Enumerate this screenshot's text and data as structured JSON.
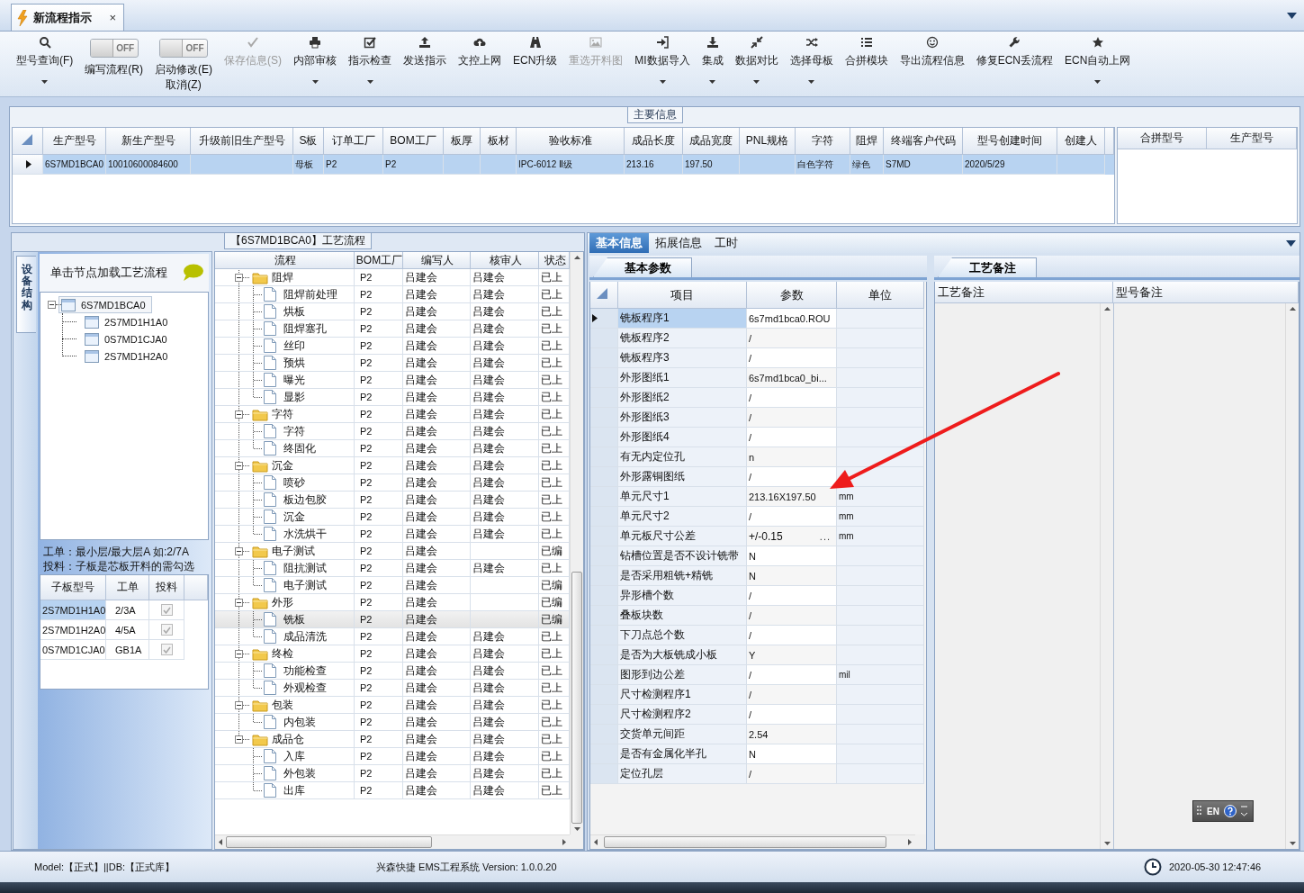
{
  "document_tab": {
    "label": "新流程指示",
    "close": "×",
    "selected": true
  },
  "toolbar": [
    {
      "kind": "button",
      "label": "型号查询(F)",
      "dropdown": true,
      "disabled": false
    },
    {
      "kind": "toggle",
      "switch": "OFF",
      "label": "编写流程(R)",
      "on": false
    },
    {
      "kind": "toggle",
      "switch": "OFF",
      "label": "启动修改(E)",
      "sublabel": "取消(Z)",
      "on": false
    },
    {
      "kind": "button",
      "label": "保存信息(S)",
      "dropdown": false,
      "disabled": true
    },
    {
      "kind": "button",
      "label": "内部审核",
      "dropdown": true,
      "disabled": false
    },
    {
      "kind": "button",
      "label": "指示检查",
      "dropdown": true,
      "disabled": false
    },
    {
      "kind": "button",
      "label": "发送指示",
      "dropdown": false,
      "disabled": false
    },
    {
      "kind": "button",
      "label": "文控上网",
      "dropdown": false,
      "disabled": false
    },
    {
      "kind": "button",
      "label": "ECN升级",
      "dropdown": false,
      "disabled": false
    },
    {
      "kind": "button",
      "label": "重选开料图",
      "dropdown": false,
      "disabled": true
    },
    {
      "kind": "button",
      "label": "MI数据导入",
      "dropdown": true,
      "disabled": false
    },
    {
      "kind": "button",
      "label": "集成",
      "dropdown": true,
      "disabled": false
    },
    {
      "kind": "button",
      "label": "数据对比",
      "dropdown": true,
      "disabled": false
    },
    {
      "kind": "button",
      "label": "选择母板",
      "dropdown": true,
      "disabled": false
    },
    {
      "kind": "button",
      "label": "合拼模块",
      "dropdown": false,
      "disabled": false
    },
    {
      "kind": "button",
      "label": "导出流程信息",
      "dropdown": false,
      "disabled": false
    },
    {
      "kind": "button",
      "label": "修复ECN丢流程",
      "dropdown": false,
      "disabled": false
    },
    {
      "kind": "button",
      "label": "ECN自动上网",
      "dropdown": true,
      "disabled": false
    }
  ],
  "main_info": {
    "title": "主要信息",
    "columns": [
      "生产型号",
      "新生产型号",
      "升级前旧生产型号",
      "S板",
      "订单工厂",
      "BOM工厂",
      "板厚",
      "板材",
      "验收标准",
      "成品长度",
      "成品宽度",
      "PNL规格",
      "字符",
      "阻焊",
      "终端客户代码",
      "型号创建时间",
      "创建人"
    ],
    "rows": [
      {
        "selected": true,
        "cells": [
          "6S7MD1BCA0",
          "10010600084600",
          null,
          "母板",
          "P2",
          "P2",
          null,
          null,
          "IPC-6012 Ⅱ级",
          "213.16",
          "197.50",
          null,
          "白色字符",
          "绿色",
          "S7MD",
          "2020/5/29",
          null
        ]
      }
    ],
    "merge_table": {
      "columns": [
        "合拼型号",
        "生产型号"
      ]
    }
  },
  "process_group": {
    "title": "【6S7MD1BCA0】工艺流程"
  },
  "device_panel": {
    "side_tab": {
      "label": "设备结构",
      "selected": true
    },
    "hint": "单击节点加载工艺流程",
    "tree": [
      {
        "label": "6S7MD1BCA0",
        "selected": true,
        "expanded": true,
        "children": [
          {
            "label": "2S7MD1H1A0",
            "selected": false
          },
          {
            "label": "0S7MD1CJA0",
            "selected": false
          },
          {
            "label": "2S7MD1H2A0",
            "selected": false
          }
        ]
      }
    ],
    "notes": [
      "工单：最小层/最大层A 如:2/7A",
      "投料：子板是芯板开料的需勾选"
    ],
    "sub_boards": {
      "columns": [
        "子板型号",
        "工单",
        "投料"
      ],
      "rows": [
        {
          "board": "2S7MD1H1A0",
          "order": "2/3A",
          "feed_checked": true,
          "selected": true
        },
        {
          "board": "2S7MD1H2A0",
          "order": "4/5A",
          "feed_checked": true,
          "selected": false
        },
        {
          "board": "0S7MD1CJA0",
          "order": "GB1A",
          "feed_checked": true,
          "selected": false
        }
      ]
    }
  },
  "flow_grid": {
    "columns": [
      "流程",
      "BOM工厂",
      "编写人",
      "核审人",
      "状态"
    ],
    "rows": [
      {
        "name": "阻焊",
        "bom": "P2",
        "writer": "吕建会",
        "reviewer": "吕建会",
        "status": "已上",
        "expanded": true,
        "selected": false,
        "children": [
          {
            "name": "阻焊前处理",
            "bom": "P2",
            "writer": "吕建会",
            "reviewer": "吕建会",
            "status": "已上",
            "selected": false
          },
          {
            "name": "烘板",
            "bom": "P2",
            "writer": "吕建会",
            "reviewer": "吕建会",
            "status": "已上",
            "selected": false
          },
          {
            "name": "阻焊塞孔",
            "bom": "P2",
            "writer": "吕建会",
            "reviewer": "吕建会",
            "status": "已上",
            "selected": false
          },
          {
            "name": "丝印",
            "bom": "P2",
            "writer": "吕建会",
            "reviewer": "吕建会",
            "status": "已上",
            "selected": false
          },
          {
            "name": "预烘",
            "bom": "P2",
            "writer": "吕建会",
            "reviewer": "吕建会",
            "status": "已上",
            "selected": false
          },
          {
            "name": "曝光",
            "bom": "P2",
            "writer": "吕建会",
            "reviewer": "吕建会",
            "status": "已上",
            "selected": false
          },
          {
            "name": "显影",
            "bom": "P2",
            "writer": "吕建会",
            "reviewer": "吕建会",
            "status": "已上",
            "selected": false
          }
        ]
      },
      {
        "name": "字符",
        "bom": "P2",
        "writer": "吕建会",
        "reviewer": "吕建会",
        "status": "已上",
        "expanded": true,
        "selected": false,
        "children": [
          {
            "name": "字符",
            "bom": "P2",
            "writer": "吕建会",
            "reviewer": "吕建会",
            "status": "已上",
            "selected": false
          },
          {
            "name": "终固化",
            "bom": "P2",
            "writer": "吕建会",
            "reviewer": "吕建会",
            "status": "已上",
            "selected": false
          }
        ]
      },
      {
        "name": "沉金",
        "bom": "P2",
        "writer": "吕建会",
        "reviewer": "吕建会",
        "status": "已上",
        "expanded": true,
        "selected": false,
        "children": [
          {
            "name": "喷砂",
            "bom": "P2",
            "writer": "吕建会",
            "reviewer": "吕建会",
            "status": "已上",
            "selected": false
          },
          {
            "name": "板边包胶",
            "bom": "P2",
            "writer": "吕建会",
            "reviewer": "吕建会",
            "status": "已上",
            "selected": false
          },
          {
            "name": "沉金",
            "bom": "P2",
            "writer": "吕建会",
            "reviewer": "吕建会",
            "status": "已上",
            "selected": false
          },
          {
            "name": "水洗烘干",
            "bom": "P2",
            "writer": "吕建会",
            "reviewer": "吕建会",
            "status": "已上",
            "selected": false
          }
        ]
      },
      {
        "name": "电子测试",
        "bom": "P2",
        "writer": "吕建会",
        "status": "已编",
        "expanded": true,
        "selected": false,
        "children": [
          {
            "name": "阻抗测试",
            "bom": "P2",
            "writer": "吕建会",
            "reviewer": "吕建会",
            "status": "已上",
            "selected": false
          },
          {
            "name": "电子测试",
            "bom": "P2",
            "writer": "吕建会",
            "status": "已编",
            "selected": false
          }
        ]
      },
      {
        "name": "外形",
        "bom": "P2",
        "writer": "吕建会",
        "status": "已编",
        "expanded": true,
        "selected": false,
        "children": [
          {
            "name": "铣板",
            "bom": "P2",
            "writer": "吕建会",
            "status": "已编",
            "selected": true
          },
          {
            "name": "成品清洗",
            "bom": "P2",
            "writer": "吕建会",
            "reviewer": "吕建会",
            "status": "已上",
            "selected": false
          }
        ]
      },
      {
        "name": "终检",
        "bom": "P2",
        "writer": "吕建会",
        "reviewer": "吕建会",
        "status": "已上",
        "expanded": true,
        "selected": false,
        "children": [
          {
            "name": "功能检查",
            "bom": "P2",
            "writer": "吕建会",
            "reviewer": "吕建会",
            "status": "已上",
            "selected": false
          },
          {
            "name": "外观检查",
            "bom": "P2",
            "writer": "吕建会",
            "reviewer": "吕建会",
            "status": "已上",
            "selected": false
          }
        ]
      },
      {
        "name": "包装",
        "bom": "P2",
        "writer": "吕建会",
        "reviewer": "吕建会",
        "status": "已上",
        "expanded": true,
        "selected": false,
        "children": [
          {
            "name": "内包装",
            "bom": "P2",
            "writer": "吕建会",
            "reviewer": "吕建会",
            "status": "已上",
            "selected": false
          }
        ]
      },
      {
        "name": "成品仓",
        "bom": "P2",
        "writer": "吕建会",
        "reviewer": "吕建会",
        "status": "已上",
        "expanded": true,
        "selected": false,
        "children": [
          {
            "name": "入库",
            "bom": "P2",
            "writer": "吕建会",
            "reviewer": "吕建会",
            "status": "已上",
            "selected": false
          },
          {
            "name": "外包装",
            "bom": "P2",
            "writer": "吕建会",
            "reviewer": "吕建会",
            "status": "已上",
            "selected": false
          },
          {
            "name": "出库",
            "bom": "P2",
            "writer": "吕建会",
            "reviewer": "吕建会",
            "status": "已上",
            "selected": false
          }
        ]
      }
    ]
  },
  "detail_tabs": [
    {
      "label": "基本信息",
      "selected": true
    },
    {
      "label": "拓展信息",
      "selected": false
    },
    {
      "label": "工时",
      "selected": false
    }
  ],
  "params": {
    "tab": "基本参数",
    "columns": [
      "项目",
      "参数",
      "单位"
    ],
    "rows": [
      {
        "item": "铣板程序1",
        "value": "6s7md1bca0.ROU",
        "selected": true
      },
      {
        "item": "铣板程序2",
        "value": "/",
        "selected": false
      },
      {
        "item": "铣板程序3",
        "value": "/",
        "selected": false
      },
      {
        "item": "外形图纸1",
        "value": "6s7md1bca0_bi...",
        "selected": false
      },
      {
        "item": "外形图纸2",
        "value": "/",
        "selected": false
      },
      {
        "item": "外形图纸3",
        "value": "/",
        "selected": false
      },
      {
        "item": "外形图纸4",
        "value": "/",
        "selected": false
      },
      {
        "item": "有无内定位孔",
        "value": "n",
        "selected": false
      },
      {
        "item": "外形露铜图纸",
        "value": "/",
        "selected": false
      },
      {
        "item": "单元尺寸1",
        "value": "213.16X197.50",
        "unit": "mm",
        "selected": false
      },
      {
        "item": "单元尺寸2",
        "value": "/",
        "unit": "mm",
        "selected": false
      },
      {
        "item": "单元板尺寸公差",
        "value": "+/-0.15",
        "button": "...",
        "unit": "mm",
        "selected": false
      },
      {
        "item": "钻槽位置是否不设计铣带",
        "value": "N",
        "selected": false
      },
      {
        "item": "是否采用粗铣+精铣",
        "value": "N",
        "selected": false
      },
      {
        "item": "异形槽个数",
        "value": "/",
        "selected": false
      },
      {
        "item": "叠板块数",
        "value": "/",
        "selected": false
      },
      {
        "item": "下刀点总个数",
        "value": "/",
        "selected": false
      },
      {
        "item": "是否为大板铣成小板",
        "value": "Y",
        "selected": false
      },
      {
        "item": "图形到边公差",
        "value": "/",
        "unit": "mil",
        "selected": false
      },
      {
        "item": "尺寸检测程序1",
        "value": "/",
        "selected": false
      },
      {
        "item": "尺寸检测程序2",
        "value": "/",
        "selected": false
      },
      {
        "item": "交货单元间距",
        "value": "2.54",
        "selected": false
      },
      {
        "item": "是否有金属化半孔",
        "value": "N",
        "selected": false
      },
      {
        "item": "定位孔层",
        "value": "/",
        "selected": false
      }
    ]
  },
  "notes_panel": {
    "tab": "工艺备注",
    "columns": [
      "工艺备注",
      "型号备注"
    ]
  },
  "language_bar": {
    "label": "EN"
  },
  "status_bar": {
    "left": "Model:【正式】||DB:【正式库】",
    "center": "兴森快捷 EMS工程系统 Version: 1.0.0.20",
    "time": "2020-05-30 12:47:46"
  }
}
